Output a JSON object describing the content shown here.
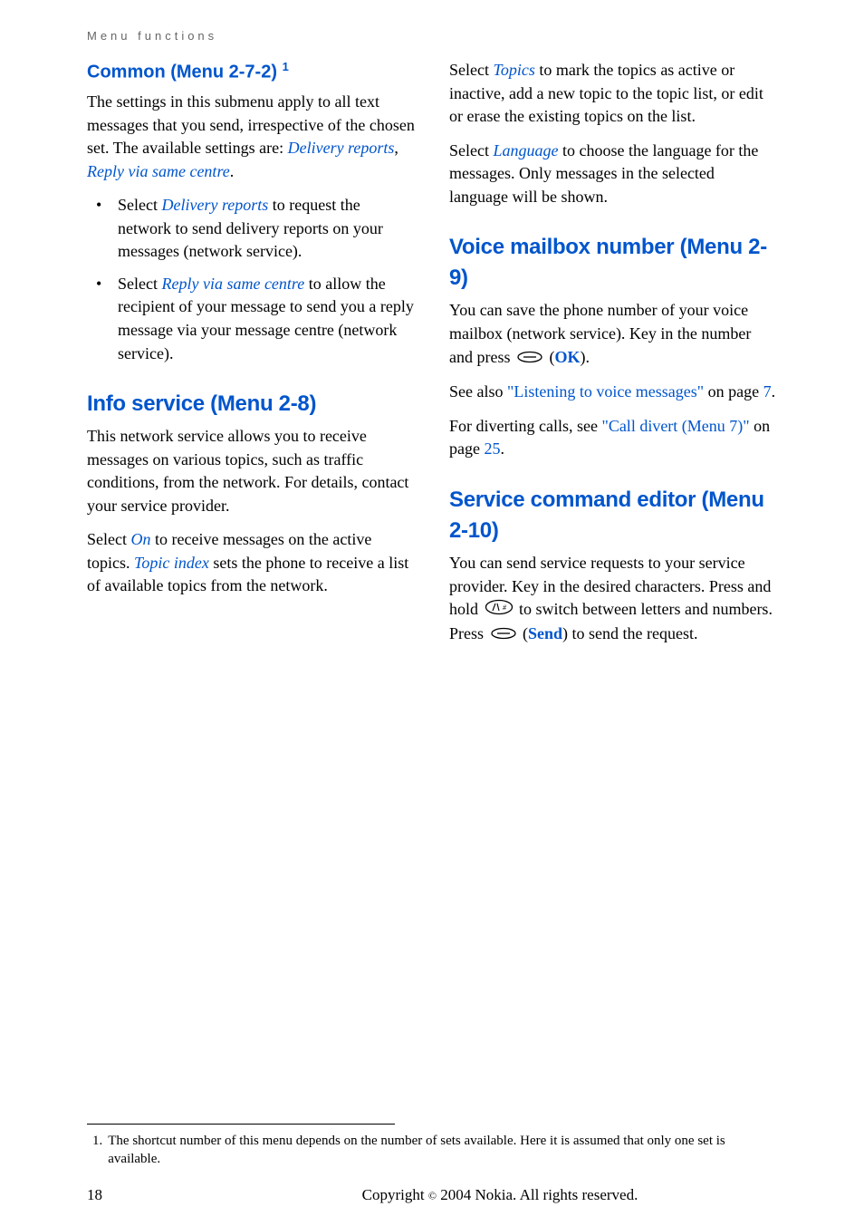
{
  "header": {
    "section": "Menu functions"
  },
  "left": {
    "common": {
      "heading": "Common (Menu 2-7-2)",
      "sup": "1",
      "intro_pre": "The settings in this submenu apply to all text messages that you send, irrespective of the chosen set. The available settings are: ",
      "setting1": "Delivery reports",
      "sep": ", ",
      "setting2": "Reply via same centre",
      "period": ".",
      "bullet1_pre": "Select ",
      "bullet1_em": "Delivery reports",
      "bullet1_post": " to request the network to send delivery reports on your messages (network service).",
      "bullet2_pre": "Select ",
      "bullet2_em": "Reply via same centre",
      "bullet2_post": " to allow the recipient of your message to send you a reply message via your message centre (network service)."
    },
    "info": {
      "heading": "Info service (Menu 2-8)",
      "p1": "This network service allows you to receive messages on various topics, such as traffic conditions, from the network. For details, contact your service provider.",
      "p2_pre": "Select ",
      "p2_em1": "On",
      "p2_mid": " to receive messages on the active topics. ",
      "p2_em2": "Topic index",
      "p2_post": " sets the phone to receive a list of available topics from the network."
    }
  },
  "right": {
    "info_cont": {
      "p1_pre": "Select ",
      "p1_em": "Topics",
      "p1_post": " to mark the topics as active or inactive, add a new topic to the topic list, or edit or erase the existing topics on the list.",
      "p2_pre": "Select ",
      "p2_em": "Language",
      "p2_post": " to choose the language for the messages. Only messages in the selected language will be shown."
    },
    "voice": {
      "heading": "Voice mailbox number (Menu 2-9)",
      "p1": "You can save the phone number of your voice mailbox (network service). Key in the number and press ",
      "ok_open": " (",
      "ok": "OK",
      "ok_close": ").",
      "p2_pre": "See also ",
      "p2_link": "\"Listening to voice messages\"",
      "p2_mid": " on page ",
      "p2_page": "7",
      "p2_end": ".",
      "p3_pre": "For diverting calls, see ",
      "p3_link": "\"Call divert (Menu 7)\"",
      "p3_mid": " on page ",
      "p3_page": "25",
      "p3_end": "."
    },
    "service": {
      "heading": "Service command editor (Menu 2-10)",
      "p1_pre": "You can send service requests to your service provider. Key in the desired characters. Press and hold ",
      "p1_mid": " to switch between letters and numbers. Press ",
      "send_open": " (",
      "send": "Send",
      "send_close": ") to send the request."
    }
  },
  "footnote": {
    "num": "1.",
    "text": "The shortcut number of this menu depends on the number of sets available. Here it is assumed that only one set is available."
  },
  "footer": {
    "page": "18",
    "copyright_pre": "Copyright ",
    "copyright_sym": "©",
    "copyright_post": " 2004 Nokia. All rights reserved."
  }
}
